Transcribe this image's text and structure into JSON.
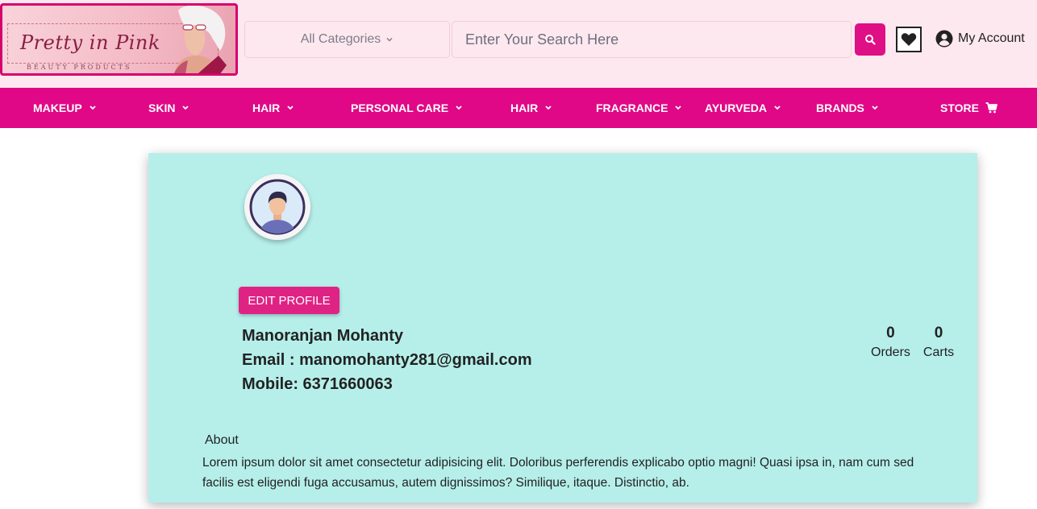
{
  "header": {
    "logo_text": "Pretty in Pink",
    "logo_subtext": "BEAUTY PRODUCTS",
    "category_select": "All Categories",
    "search_placeholder": "Enter Your Search Here",
    "account_label": "My Account"
  },
  "nav": {
    "items": [
      {
        "label": "MAKEUP",
        "icon": "chevron-down-icon"
      },
      {
        "label": "SKIN",
        "icon": "chevron-down-icon"
      },
      {
        "label": "HAIR",
        "icon": "chevron-down-icon"
      },
      {
        "label": "PERSONAL CARE",
        "icon": "chevron-down-icon"
      },
      {
        "label": "HAIR",
        "icon": "chevron-down-icon"
      },
      {
        "label": "FRAGRANCE",
        "icon": "chevron-down-icon"
      },
      {
        "label": "AYURVEDA",
        "icon": "chevron-down-icon"
      },
      {
        "label": "BRANDS",
        "icon": "chevron-down-icon"
      },
      {
        "label": "STORE",
        "icon": "cart-icon"
      }
    ]
  },
  "profile": {
    "edit_button": "EDIT PROFILE",
    "name": "Manoranjan Mohanty",
    "email_line": "Email : manomohanty281@gmail.com",
    "mobile_line": "Mobile: 6371660063",
    "stats": [
      {
        "value": "0",
        "label": "Orders"
      },
      {
        "value": "0",
        "label": "Carts"
      }
    ],
    "about_title": "About",
    "about_text": "Lorem ipsum dolor sit amet consectetur adipisicing elit. Doloribus perferendis explicabo optio magni! Quasi ipsa in, nam cum sed facilis est eligendi fuga accusamus, autem dignissimos? Similique, itaque. Distinctio, ab."
  },
  "colors": {
    "brand_pink": "#e00887",
    "header_bg": "#fde8ef",
    "card_bg": "#b6efea"
  }
}
